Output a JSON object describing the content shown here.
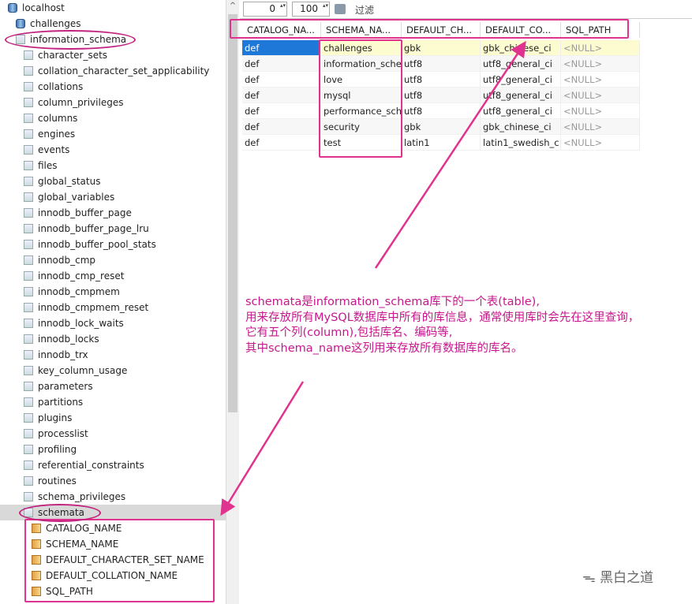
{
  "tree": {
    "server": "localhost",
    "databases": [
      "challenges",
      "information_schema"
    ],
    "tables": [
      "character_sets",
      "collation_character_set_applicability",
      "collations",
      "column_privileges",
      "columns",
      "engines",
      "events",
      "files",
      "global_status",
      "global_variables",
      "innodb_buffer_page",
      "innodb_buffer_page_lru",
      "innodb_buffer_pool_stats",
      "innodb_cmp",
      "innodb_cmp_reset",
      "innodb_cmpmem",
      "innodb_cmpmem_reset",
      "innodb_lock_waits",
      "innodb_locks",
      "innodb_trx",
      "key_column_usage",
      "parameters",
      "partitions",
      "plugins",
      "processlist",
      "profiling",
      "referential_constraints",
      "routines",
      "schema_privileges",
      "schemata"
    ],
    "selected_table": "schemata",
    "columns": [
      "CATALOG_NAME",
      "SCHEMA_NAME",
      "DEFAULT_CHARACTER_SET_NAME",
      "DEFAULT_COLLATION_NAME",
      "SQL_PATH"
    ]
  },
  "toolbar": {
    "offset": "0",
    "limit": "100",
    "filter_label": "过滤"
  },
  "grid": {
    "headers": [
      "CATALOG_NA...",
      "SCHEMA_NA...",
      "DEFAULT_CH...",
      "DEFAULT_CO...",
      "SQL_PATH"
    ],
    "rows": [
      [
        "def",
        "challenges",
        "gbk",
        "gbk_chinese_ci",
        "<NULL>"
      ],
      [
        "def",
        "information_sche",
        "utf8",
        "utf8_general_ci",
        "<NULL>"
      ],
      [
        "def",
        "love",
        "utf8",
        "utf8_general_ci",
        "<NULL>"
      ],
      [
        "def",
        "mysql",
        "utf8",
        "utf8_general_ci",
        "<NULL>"
      ],
      [
        "def",
        "performance_sch",
        "utf8",
        "utf8_general_ci",
        "<NULL>"
      ],
      [
        "def",
        "security",
        "gbk",
        "gbk_chinese_ci",
        "<NULL>"
      ],
      [
        "def",
        "test",
        "latin1",
        "latin1_swedish_c",
        "<NULL>"
      ]
    ]
  },
  "annotation": {
    "lines": [
      "schemata是information_schema库下的一个表(table),",
      "用来存放所有MySQL数据库中所有的库信息，通常使用库时会先在这里查询，",
      "它有五个列(column),包括库名、编码等,",
      "其中schema_name这列用来存放所有数据库的库名。"
    ]
  },
  "watermark": "黑白之道",
  "colors": {
    "annotation": "#c8168e",
    "highlight": "#e0338f",
    "selection": "#1e78d7"
  }
}
